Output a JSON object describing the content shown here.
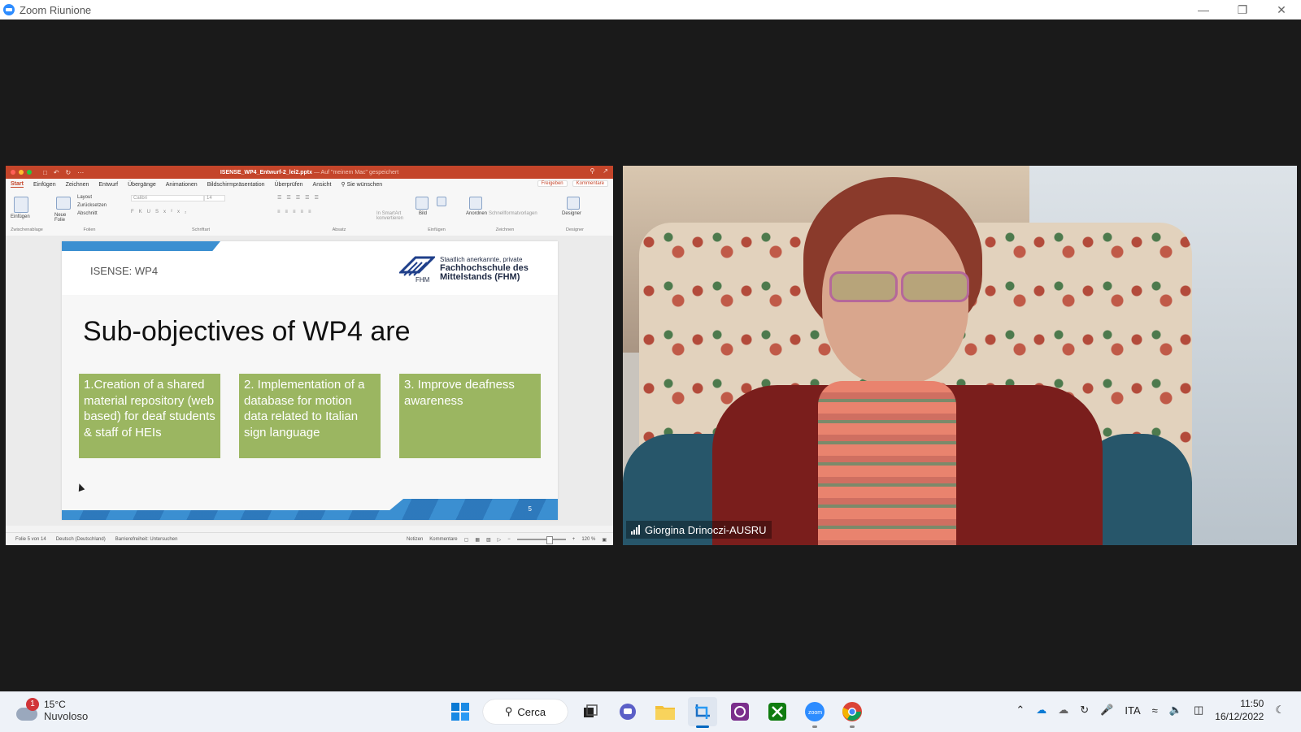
{
  "window": {
    "title": "Zoom Riunione"
  },
  "ppt": {
    "doc_name": "ISENSE_WP4_Entwurf-2_lei2.pptx",
    "doc_status": "— Auf \"meinem Mac\" gespeichert",
    "tabs": [
      "Start",
      "Einfügen",
      "Zeichnen",
      "Entwurf",
      "Übergänge",
      "Animationen",
      "Bildschirmpräsentation",
      "Überprüfen",
      "Ansicht"
    ],
    "tell_me": "Sie wünschen",
    "share_label": "Freigeben",
    "comments_label": "Kommentare",
    "ribbon": {
      "paste": "Einfügen",
      "new_slide": "Neue Folie",
      "layout": "Layout",
      "reset": "Zurücksetzen",
      "section": "Abschnitt",
      "font": "Calibri",
      "font_size": "14",
      "smartart": "In SmartArt konvertieren",
      "picture": "Bild",
      "arrange": "Anordnen",
      "quick_styles": "Schnellformatvorlagen",
      "designer": "Designer",
      "groups": [
        "Zwischenablage",
        "Folien",
        "Schriftart",
        "Absatz",
        "Einfügen",
        "Zeichnen",
        "Designer"
      ]
    },
    "slide": {
      "label": "ISENSE: WP4",
      "logo_line1": "Staatlich anerkannte, private",
      "logo_line2": "Fachhochschule des",
      "logo_line3": "Mittelstands (FHM)",
      "logo_mark": "FHM",
      "headline": "Sub-objectives of WP4 are",
      "boxes": [
        "1.Creation of a shared material repository (web based) for deaf students & staff of HEIs",
        "2. Implementation of a database for motion data related to Italian sign language",
        "3. Improve deafness awareness"
      ],
      "page_number": "5",
      "box_color": "#9bb661",
      "accent_color": "#3b8fd1"
    },
    "status": {
      "slide_count": "Folie 5 von 14",
      "language": "Deutsch (Deutschland)",
      "accessibility": "Barrierefreiheit: Untersuchen",
      "notes": "Notizen",
      "comments": "Kommentare",
      "zoom": "120 %"
    }
  },
  "video": {
    "participant_name": "Giorgina Drinoczi-AUSRU"
  },
  "taskbar": {
    "weather_temp": "15°C",
    "weather_desc": "Nuvoloso",
    "weather_badge": "1",
    "search_label": "Cerca",
    "language": "ITA",
    "time": "11:50",
    "date": "16/12/2022"
  },
  "colors": {
    "ppt_red": "#c4452a",
    "zoom_blue": "#2d8cff",
    "background": "#1a1a1a"
  }
}
